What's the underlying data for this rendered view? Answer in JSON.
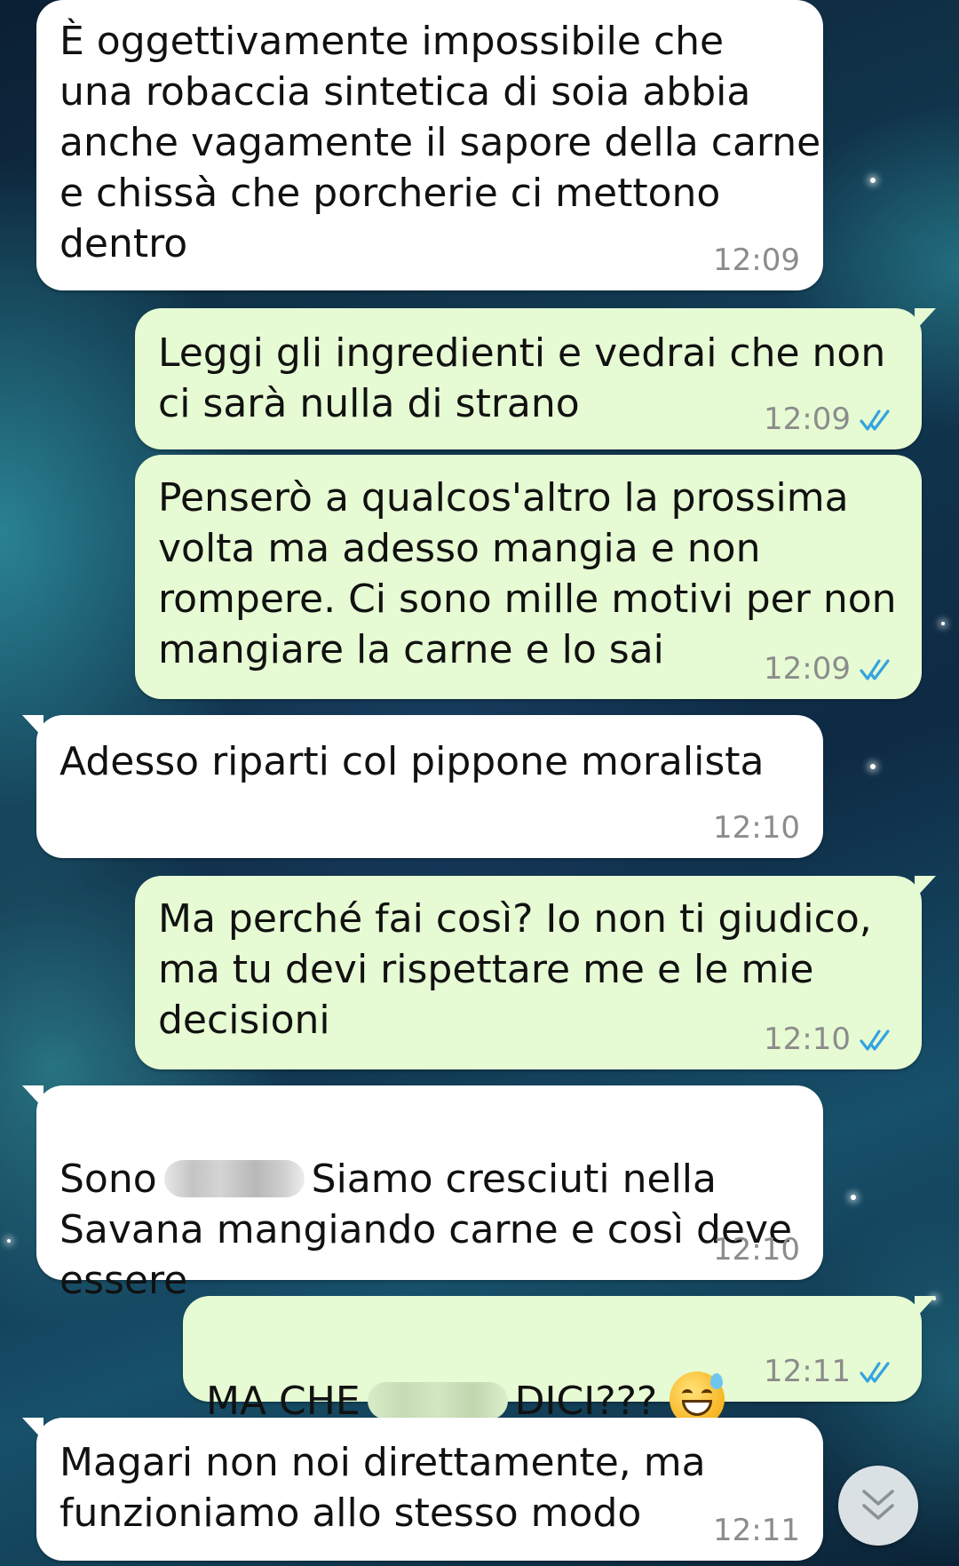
{
  "messages": [
    {
      "direction": "incoming",
      "text": "È oggettivamente impossibile che\nuna robaccia sintetica di soia abbia\nanche vagamente il sapore della carne\ne chissà che porcherie ci mettono\ndentro",
      "time": "12:09"
    },
    {
      "direction": "outgoing",
      "text": "Leggi gli ingredienti e vedrai che non\nci sarà nulla di strano",
      "time": "12:09",
      "status": "read"
    },
    {
      "direction": "outgoing",
      "text": "Penserò a qualcos'altro la prossima\nvolta ma adesso mangia e non\nrompere. Ci sono mille motivi per non\nmangiare la carne e lo sai",
      "time": "12:09",
      "status": "read"
    },
    {
      "direction": "incoming",
      "text": "Adesso riparti col pippone moralista",
      "time": "12:10"
    },
    {
      "direction": "outgoing",
      "text": "Ma perché fai così? Io non ti giudico,\nma tu devi rispettare me e le mie\ndecisioni",
      "time": "12:10",
      "status": "read"
    },
    {
      "direction": "incoming",
      "text_before_redaction": "Sono",
      "text_after_redaction": "Siamo cresciuti nella",
      "text_rest": "Savana mangiando carne e così deve\nessere",
      "time": "12:10"
    },
    {
      "direction": "outgoing",
      "text_before_redaction": "MA CHE",
      "text_after_redaction": "DICI???",
      "emoji": "grinning-face-with-sweat",
      "time": "12:11",
      "status": "read"
    },
    {
      "direction": "incoming",
      "text": "Magari non noi direttamente, ma\nfunzioniamo allo stesso modo",
      "time": "12:11"
    }
  ],
  "scroll_button": {
    "icon": "double-chevron-down-icon"
  },
  "colors": {
    "incoming_bubble": "#ffffff",
    "outgoing_bubble": "#e6fbd3",
    "read_ticks": "#34a3e0",
    "timestamp": "#8c8c8c"
  }
}
